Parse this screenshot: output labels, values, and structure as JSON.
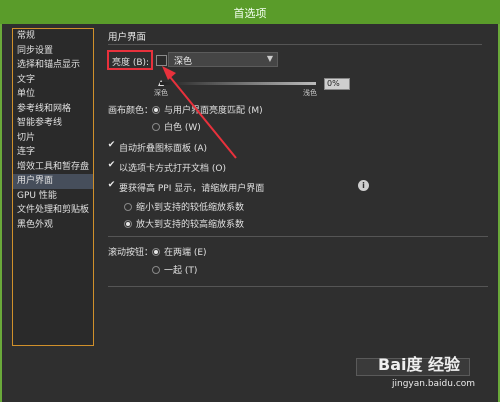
{
  "window": {
    "title": "首选项"
  },
  "sidebar": {
    "items": [
      {
        "label": "常规"
      },
      {
        "label": "同步设置"
      },
      {
        "label": "选择和锚点显示"
      },
      {
        "label": "文字"
      },
      {
        "label": "单位"
      },
      {
        "label": "参考线和网格"
      },
      {
        "label": "智能参考线"
      },
      {
        "label": "切片"
      },
      {
        "label": "连字"
      },
      {
        "label": "增效工具和暂存盘"
      },
      {
        "label": "用户界面"
      },
      {
        "label": "GPU 性能"
      },
      {
        "label": "文件处理和剪贴板"
      },
      {
        "label": "黑色外观"
      }
    ],
    "selected_index": 10
  },
  "panel": {
    "section_title": "用户界面",
    "brightness": {
      "label": "亮度 (B):",
      "selected": "深色",
      "slider_left": "深色",
      "slider_right": "浅色",
      "value": "0%"
    },
    "canvas_color": {
      "label": "画布颜色：",
      "option1": "与用户界面亮度匹配 (M)",
      "option2": "白色 (W)",
      "selected": 1
    },
    "auto_collapse": {
      "label": "自动折叠图标面板 (A)",
      "checked": true
    },
    "open_tabs": {
      "label": "以选项卡方式打开文档 (O)",
      "checked": true
    },
    "ppi": {
      "label": "要获得高 PPI 显示，请缩放用户界面",
      "checked": true,
      "option1": "缩小到支持的较低缩放系数",
      "option2": "放大到支持的较高缩放系数",
      "selected": 2
    },
    "scroll": {
      "label": "滚动按钮：",
      "option1": "在两端 (E)",
      "option2": "一起 (T)",
      "selected": 1
    }
  },
  "watermark": {
    "brand": "Bai度 经验",
    "url": "jingyan.baidu.com"
  },
  "colors": {
    "accent_green": "#5a9c2a",
    "sidebar_border": "#d0902b",
    "annotation_red": "#e8313c",
    "selected_bg": "#464e5b"
  }
}
